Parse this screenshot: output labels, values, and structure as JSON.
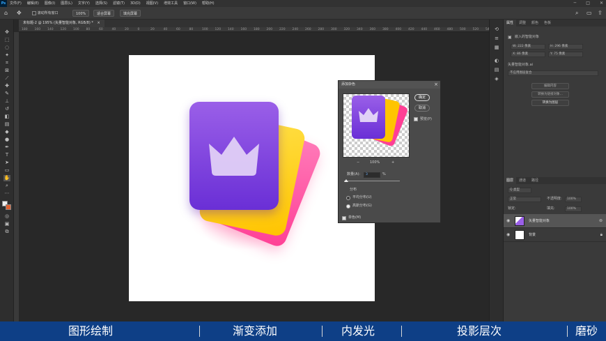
{
  "menubar": {
    "logo": "Ps",
    "items": [
      "文件(F)",
      "编辑(E)",
      "图像(I)",
      "图层(L)",
      "文字(Y)",
      "选择(S)",
      "滤镜(T)",
      "3D(D)",
      "视图(V)",
      "增效工具",
      "窗口(W)",
      "帮助(H)"
    ],
    "minimize": "─",
    "maximize": "□",
    "close": "✕"
  },
  "options": {
    "move_icon": "move-icon",
    "checkbox_label": "滚动所有窗口",
    "zoom": "100%",
    "fit_screen": "适合屏幕",
    "fill_screen": "填充屏幕"
  },
  "document_tab": {
    "title": "未标题-2 @ 195% (矢量智能对象, RGB/8) *",
    "close": "×"
  },
  "ruler_numbers": [
    "180",
    "160",
    "140",
    "120",
    "100",
    "80",
    "60",
    "40",
    "20",
    "0",
    "20",
    "40",
    "60",
    "80",
    "100",
    "120",
    "140",
    "160",
    "180",
    "200",
    "220",
    "240",
    "260",
    "280",
    "300",
    "320",
    "340",
    "360",
    "380",
    "400",
    "420",
    "440",
    "460",
    "480",
    "500",
    "520",
    "540"
  ],
  "dialog": {
    "title": "添加杂色",
    "close": "×",
    "ok": "确定",
    "cancel": "取消",
    "preview_label": "预览(P)",
    "zoom_value": "100%",
    "zoom_out": "−",
    "zoom_in": "+",
    "amount_label": "数量(A):",
    "amount_value": "3",
    "amount_unit": "%",
    "distribution_label": "分布",
    "uniform": "平均分布(U)",
    "gaussian": "高斯分布(G)",
    "mono": "单色(M)"
  },
  "properties_panel": {
    "tabs": [
      "属性",
      "调整",
      "颜色",
      "色板"
    ],
    "object_type": "嵌入的智能对象",
    "w": "W: 222 像素",
    "h": "H: 296 像素",
    "x": "X: 86 像素",
    "y": "Y: 75 像素",
    "file_name": "矢量智能对象.ai",
    "layer_comp": "不应用图层复合",
    "edit_contents": "编辑内容",
    "convert_linked": "转换为链接对象...",
    "convert_layers": "转换为图层"
  },
  "layers_panel": {
    "tabs": [
      "图层",
      "通道",
      "路径"
    ],
    "kind": "Q 类型",
    "blend_mode": "正常",
    "opacity_label": "不透明度:",
    "opacity": "100%",
    "lock_label": "锁定:",
    "fill_label": "填充:",
    "fill": "100%",
    "layers": [
      {
        "name": "矢量智能对象",
        "selected": true
      },
      {
        "name": "背景",
        "selected": false
      }
    ]
  },
  "caption": {
    "items": [
      "图形绘制",
      "渐变添加",
      "内发光",
      "投影层次",
      "磨砂"
    ]
  },
  "colors": {
    "card_purple_top": "#9a5fe8",
    "card_purple_bottom": "#6a2fd6",
    "card_yellow": "#ffd21a",
    "card_pink": "#ff4fa0",
    "caption_bg": "#0e3f86"
  }
}
